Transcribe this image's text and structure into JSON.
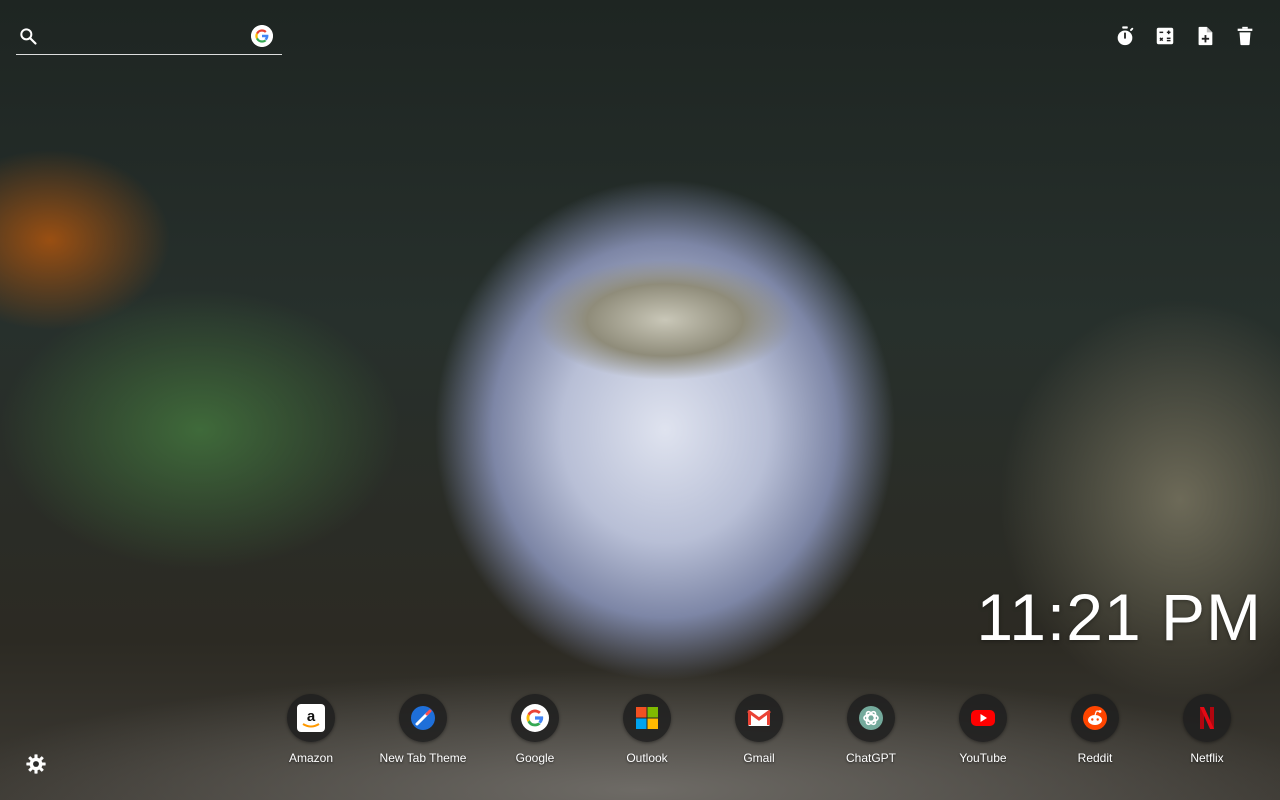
{
  "search": {
    "value": "",
    "placeholder": "",
    "icon": "search-icon",
    "engine_icon": "google-icon"
  },
  "toolbar": {
    "buttons": [
      {
        "name": "timer-button",
        "icon": "stopwatch-icon"
      },
      {
        "name": "calculator-button",
        "icon": "calculator-icon"
      },
      {
        "name": "new-note-button",
        "icon": "note-add-icon"
      },
      {
        "name": "delete-button",
        "icon": "trash-icon"
      }
    ]
  },
  "clock": {
    "time": "11:21 PM"
  },
  "shortcuts": [
    {
      "label": "Amazon",
      "icon": "amazon-icon"
    },
    {
      "label": "New Tab Theme",
      "icon": "new-tab-theme-icon"
    },
    {
      "label": "Google",
      "icon": "google-icon"
    },
    {
      "label": "Outlook",
      "icon": "windows-icon"
    },
    {
      "label": "Gmail",
      "icon": "gmail-icon"
    },
    {
      "label": "ChatGPT",
      "icon": "chatgpt-icon"
    },
    {
      "label": "YouTube",
      "icon": "youtube-icon"
    },
    {
      "label": "Reddit",
      "icon": "reddit-icon"
    },
    {
      "label": "Netflix",
      "icon": "netflix-icon"
    }
  ],
  "settings": {
    "icon": "gear-icon"
  },
  "colors": {
    "youtube": "#ff0000",
    "reddit": "#ff4500",
    "netflix": "#e50914",
    "google_blue": "#4285f4",
    "google_red": "#ea4335",
    "google_yellow": "#fbbc05",
    "google_green": "#34a853"
  }
}
